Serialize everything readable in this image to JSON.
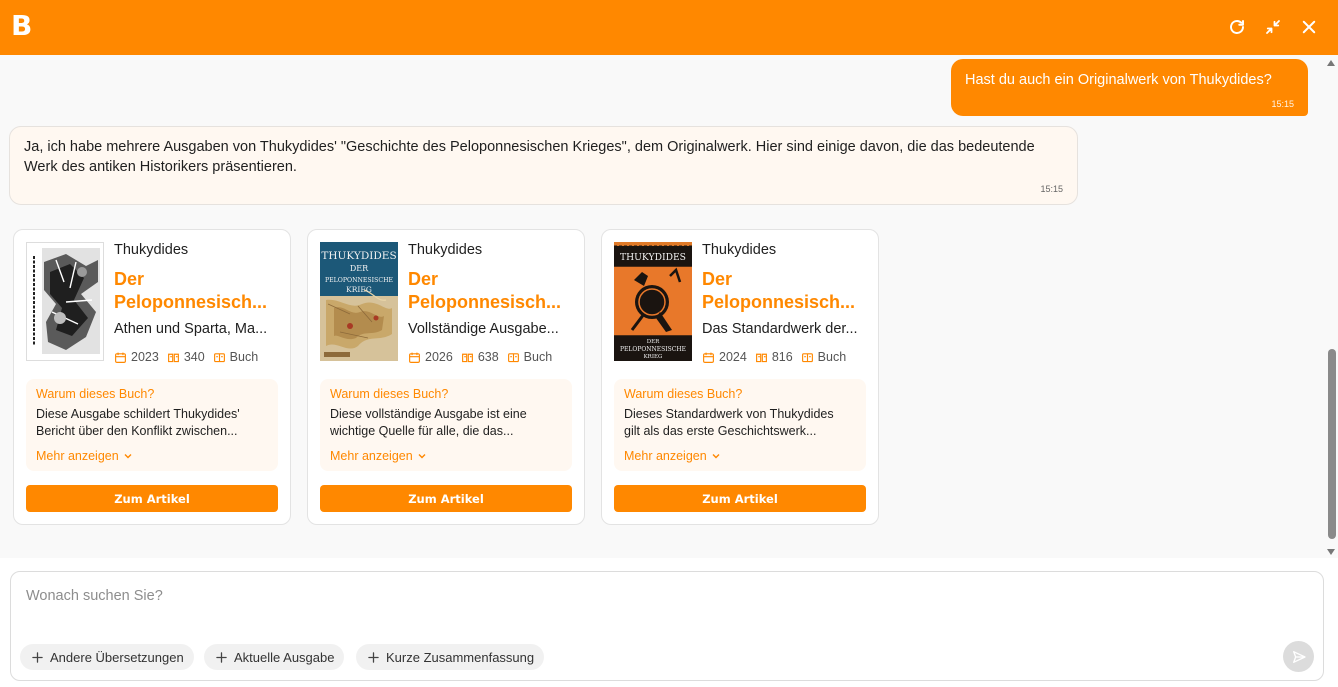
{
  "header": {
    "logo_text": "B",
    "accent_color": "#ff8800",
    "buttons": [
      {
        "name": "refresh-icon"
      },
      {
        "name": "minimize-icon"
      },
      {
        "name": "close-icon"
      }
    ]
  },
  "messages": {
    "user": {
      "text": "Hast du auch ein Originalwerk von Thukydides?",
      "time": "15:15"
    },
    "bot": {
      "text": "Ja, ich habe mehrere Ausgaben von Thukydides' \"Geschichte des Peloponnesischen Krieges\", dem Originalwerk. Hier sind einige davon, die das bedeutende Werk des antiken Historikers präsentieren.",
      "time": "15:15"
    }
  },
  "books": [
    {
      "author": "Thukydides",
      "title_line1": "Der",
      "title_line2": "Peloponnesisch...",
      "subtitle": "Athen und Sparta, Ma...",
      "year": "2023",
      "pages": "340",
      "format": "Buch",
      "why_heading": "Warum dieses Buch?",
      "why_line1": "Diese Ausgabe schildert Thukydides'",
      "why_line2": "Bericht über den Konflikt zwischen...",
      "more_label": "Mehr anzeigen",
      "cta_label": "Zum Artikel"
    },
    {
      "author": "Thukydides",
      "title_line1": "Der",
      "title_line2": "Peloponnesisch...",
      "subtitle": "Vollständige Ausgabe...",
      "year": "2026",
      "pages": "638",
      "format": "Buch",
      "cover_title": "THUKYDIDES",
      "cover_line1": "DER",
      "cover_line2": "PELOPONNESISCHE",
      "cover_line3": "KRIEG",
      "why_heading": "Warum dieses Buch?",
      "why_line1": "Diese vollständige Ausgabe ist eine",
      "why_line2": "wichtige Quelle für alle, die das...",
      "more_label": "Mehr anzeigen",
      "cta_label": "Zum Artikel"
    },
    {
      "author": "Thukydides",
      "title_line1": "Der",
      "title_line2": "Peloponnesisch...",
      "subtitle": "Das Standardwerk der...",
      "year": "2024",
      "pages": "816",
      "format": "Buch",
      "cover_title": "THUKYDIDES",
      "cover_line1": "DER",
      "cover_line2": "PELOPONNESISCHE",
      "cover_line3": "KRIEG",
      "why_heading": "Warum dieses Buch?",
      "why_line1": "Dieses Standardwerk von Thukydides",
      "why_line2": "gilt als das erste Geschichtswerk...",
      "more_label": "Mehr anzeigen",
      "cta_label": "Zum Artikel"
    }
  ],
  "composer": {
    "placeholder": "Wonach suchen Sie?",
    "chips": [
      "Andere Übersetzungen",
      "Aktuelle Ausgabe",
      "Kurze Zusammenfassung"
    ]
  }
}
